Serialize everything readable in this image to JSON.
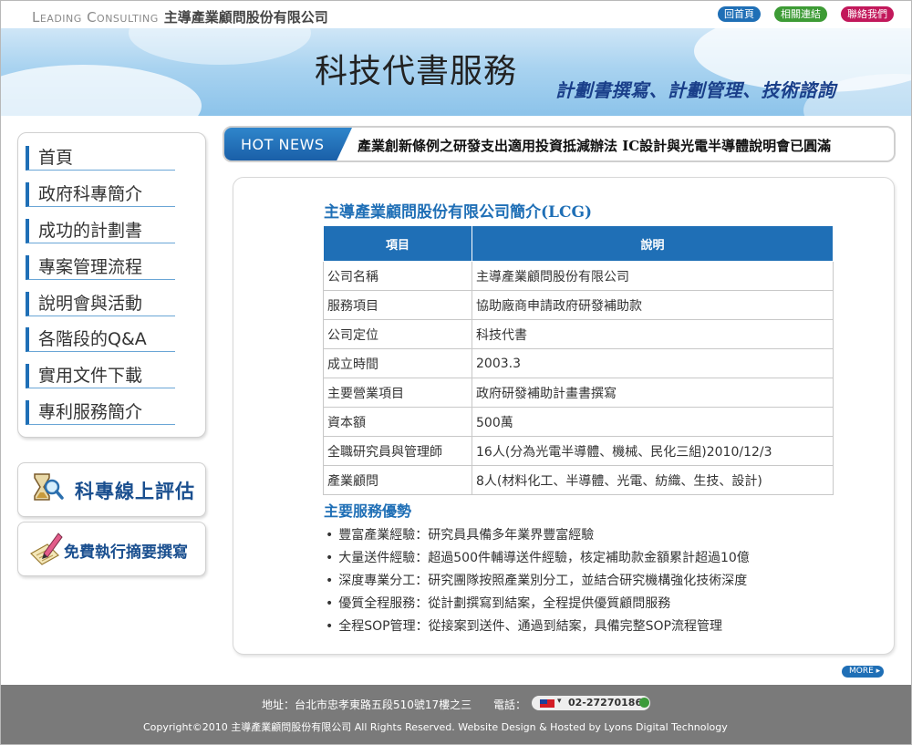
{
  "topbar": {
    "brand_en": "Leading Consulting",
    "brand_cn": "主導產業顧問股份有限公司",
    "buttons": {
      "home": "回首頁",
      "links": "相關連結",
      "contact": "聯絡我們"
    }
  },
  "banner": {
    "title": "科技代書服務",
    "subtitle": "計劃書撰寫、計劃管理、技術諮詢"
  },
  "nav": {
    "items": [
      "首頁",
      "政府科專簡介",
      "成功的計劃書",
      "專案管理流程",
      "說明會與活動",
      "各階段的Q&A",
      "實用文件下載",
      "專利服務簡介"
    ]
  },
  "promos": {
    "evaluate": "科專線上評估",
    "summary": "免費執行摘要撰寫"
  },
  "news": {
    "label": "HOT NEWS",
    "text": "產業創新條例之研發支出適用投資抵減辦法 IC設計與光電半導體說明會已圓滿"
  },
  "content": {
    "title": "主導產業顧問股份有限公司簡介(LCG)",
    "table": {
      "headers": [
        "項目",
        "說明"
      ],
      "rows": [
        [
          "公司名稱",
          "主導產業顧問股份有限公司"
        ],
        [
          "服務項目",
          "協助廠商申請政府研發補助款"
        ],
        [
          "公司定位",
          "科技代書"
        ],
        [
          "成立時間",
          "2003.3"
        ],
        [
          "主要營業項目",
          "政府研發補助計畫書撰寫"
        ],
        [
          "資本額",
          "500萬"
        ],
        [
          "全職研究員與管理師",
          "16人(分為光電半導體、機械、民化三組)2010/12/3"
        ],
        [
          "產業顧問",
          "8人(材料化工、半導體、光電、紡織、生技、設計)"
        ]
      ]
    },
    "advantages_title": "主要服務優勢",
    "advantages": [
      "豐富產業經驗：研究員具備多年業界豐富經驗",
      "大量送件經驗：超過500件輔導送件經驗，核定補助款金額累計超過10億",
      "深度專業分工：研究團隊按照產業別分工，並結合研究機構強化技術深度",
      "優質全程服務：從計劃撰寫到結案，全程提供優質顧問服務",
      "全程SOP管理：從接案到送件、通過到結案，具備完整SOP流程管理"
    ],
    "more": "MORE"
  },
  "footer": {
    "address": "地址：台北市忠孝東路五段510號17樓之三",
    "phone_label": "電話：",
    "phone": "02-27270186",
    "copyright": "Copyright©2010 主導產業顧問股份有限公司 All Rights Reserved. Website Design & Hosted by Lyons Digital Technology"
  },
  "colors": {
    "accent": "#1f6fb6",
    "green": "#3d9b35",
    "magenta": "#c2185b",
    "footer": "#7a7a7a"
  }
}
